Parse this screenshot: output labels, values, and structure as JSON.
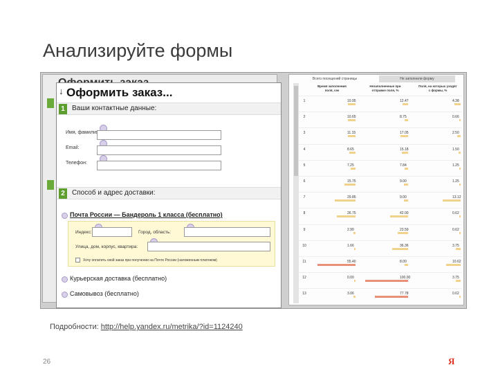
{
  "slide": {
    "title": "Анализируйте формы",
    "footnote_prefix": "Подробности:",
    "footnote_link": "http://help.yandex.ru/metrika/?id=1124240",
    "page_number": "26",
    "logo": "Я"
  },
  "form": {
    "title": "Оформить заказ...",
    "section1": {
      "number": "1",
      "label": "Ваши контактные данные:"
    },
    "fields": [
      {
        "label": "Имя, фамилия:"
      },
      {
        "label": "Email:"
      },
      {
        "label": "Телефон:"
      }
    ],
    "section2": {
      "number": "2",
      "label": "Способ и адрес доставки:"
    },
    "delivery_main": "Почта России — Бандероль 1 класса (бесплатно)",
    "address": {
      "index_label": "Индекс:",
      "city_label": "Город, область:",
      "street_label": "Улица, дом, корпус, квартира:",
      "checkbox_label": "Хочу оплатить свой заказ при получении на Почте России (наложенным платежом)"
    },
    "delivery_courier": "Курьерская доставка (бесплатно)",
    "delivery_pickup": "Самовывоз (бесплатно)"
  },
  "stats": {
    "tabs": [
      "Всего посещений страницы",
      "Не заполнили форму"
    ],
    "headers": [
      "Время заполнения поля, сек",
      "Незаполненные при отправке поля, %",
      "Поля, на которых уходят с формы, %"
    ],
    "rows": [
      {
        "n": "1",
        "a": "10.95",
        "b": "12.47",
        "c": "4.38"
      },
      {
        "n": "2",
        "a": "10.65",
        "b": "8.75",
        "c": "0.66"
      },
      {
        "n": "3",
        "a": "11.15",
        "b": "17.05",
        "c": "2.50"
      },
      {
        "n": "4",
        "a": "8.65",
        "b": "15.18",
        "c": "1.50"
      },
      {
        "n": "5",
        "a": "7.25",
        "b": "7.84",
        "c": "1.25"
      },
      {
        "n": "6",
        "a": "15.75",
        "b": "9.00",
        "c": "1.25"
      },
      {
        "n": "7",
        "a": "29.85",
        "b": "9.00",
        "c": "13.12"
      },
      {
        "n": "8",
        "a": "26.75",
        "b": "42.00",
        "c": "0.62"
      },
      {
        "n": "9",
        "a": "2.90",
        "b": "23.59",
        "c": "0.62"
      },
      {
        "n": "10",
        "a": "1.66",
        "b": "36.36",
        "c": "3.75"
      },
      {
        "n": "11",
        "a": "55.40",
        "b": "8.00",
        "c": "10.62"
      },
      {
        "n": "12",
        "a": "0.00",
        "b": "100.00",
        "c": "3.75"
      },
      {
        "n": "13",
        "a": "3.06",
        "b": "77.78",
        "c": "0.62"
      }
    ]
  },
  "colors": {
    "green": "#5e9e2e",
    "bar_yellow": "#f2d28a",
    "bar_red": "#e8907a",
    "logo": "#e03020"
  }
}
